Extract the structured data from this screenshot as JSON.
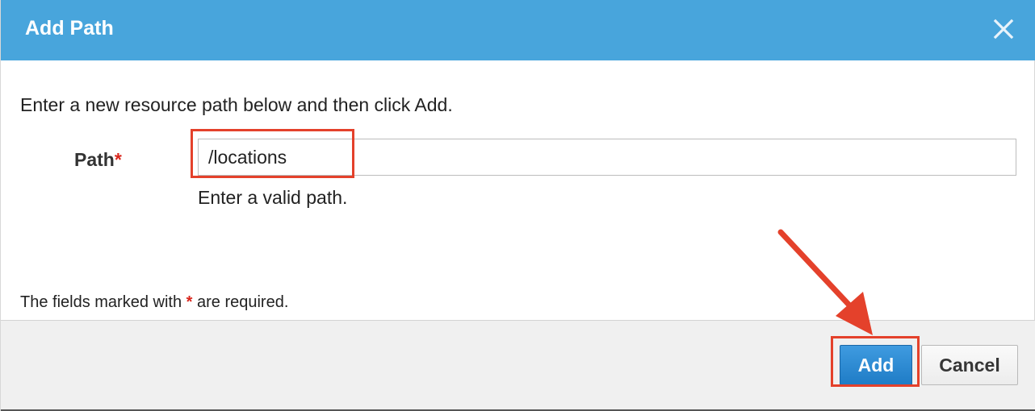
{
  "dialog": {
    "title": "Add Path",
    "intro": "Enter a new resource path below and then click Add.",
    "path_field": {
      "label": "Path",
      "required_marker": "*",
      "value": "/locations",
      "help": "Enter a valid path."
    },
    "required_note": {
      "prefix": "The fields marked with ",
      "marker": "*",
      "suffix": " are required."
    },
    "buttons": {
      "add_label": "Add",
      "cancel_label": "Cancel"
    },
    "close_icon": "close-icon"
  },
  "colors": {
    "header_bg": "#48a5dc",
    "primary_button": "#2a8ad6",
    "required_star": "#d9261c",
    "annotation": "#e4412b",
    "footer_bg": "#f0f0f0"
  }
}
